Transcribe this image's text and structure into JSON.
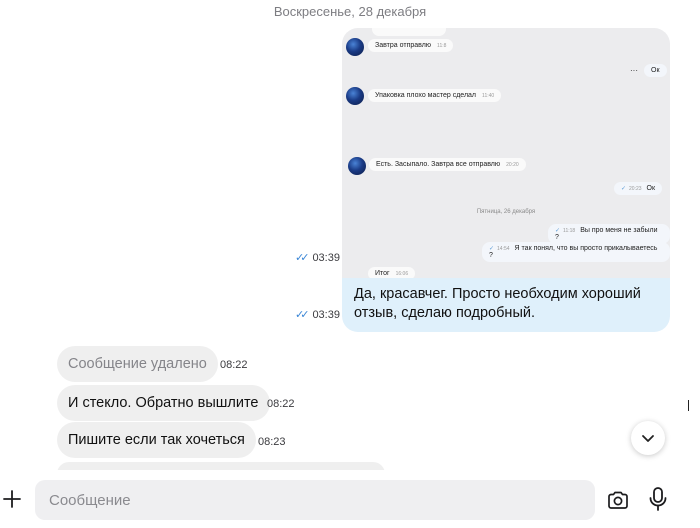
{
  "date_separator": "Воскресенье, 28 декабря",
  "screenshot_image": {
    "rows": [
      {
        "side": "in",
        "avatar": true,
        "text": "Завтра отправлю",
        "time": "11:8"
      },
      {
        "side": "out",
        "text": "Ок",
        "time": "",
        "dots": "···"
      },
      {
        "side": "in",
        "avatar": true,
        "text": "Упаковка плохо мастер сделал",
        "time": "11:40"
      },
      {
        "side": "in",
        "avatar": true,
        "text": "Есть. Засыпало. Завтра все отправлю",
        "time": "20:20"
      },
      {
        "side": "out",
        "text": "Ок",
        "time": "20:23"
      },
      {
        "side": "out",
        "text": "Вы про меня не забыли ?",
        "time": "11:18"
      },
      {
        "side": "out",
        "text": "Я так понял, что вы просто прикалываетесь ?",
        "time": "14:54"
      },
      {
        "side": "in",
        "avatar": false,
        "text": "Итог",
        "time": "16:06"
      }
    ],
    "date_label": "Пятница, 26 декабря"
  },
  "outgoing": [
    {
      "time": "03:39"
    },
    {
      "text": "Да, красавчег. Просто необходим хороший отзыв, сделаю подробный.",
      "time": "03:39"
    }
  ],
  "incoming": [
    {
      "text": "Сообщение удалено",
      "time": "08:22",
      "deleted": true
    },
    {
      "text": "И стекло. Обратно вышлите",
      "time": "08:22"
    },
    {
      "text": "Пишите если так хочеться",
      "time": "08:23"
    }
  ],
  "composer": {
    "placeholder": "Сообщение"
  },
  "colors": {
    "outgoing_bubble": "#dff0fb",
    "incoming_bubble": "#efefef",
    "read_ticks": "#3a86d6"
  },
  "icons": {
    "scroll_down": "chevron-down-icon",
    "attach": "plus-icon",
    "camera": "camera-icon",
    "mic": "microphone-icon"
  }
}
